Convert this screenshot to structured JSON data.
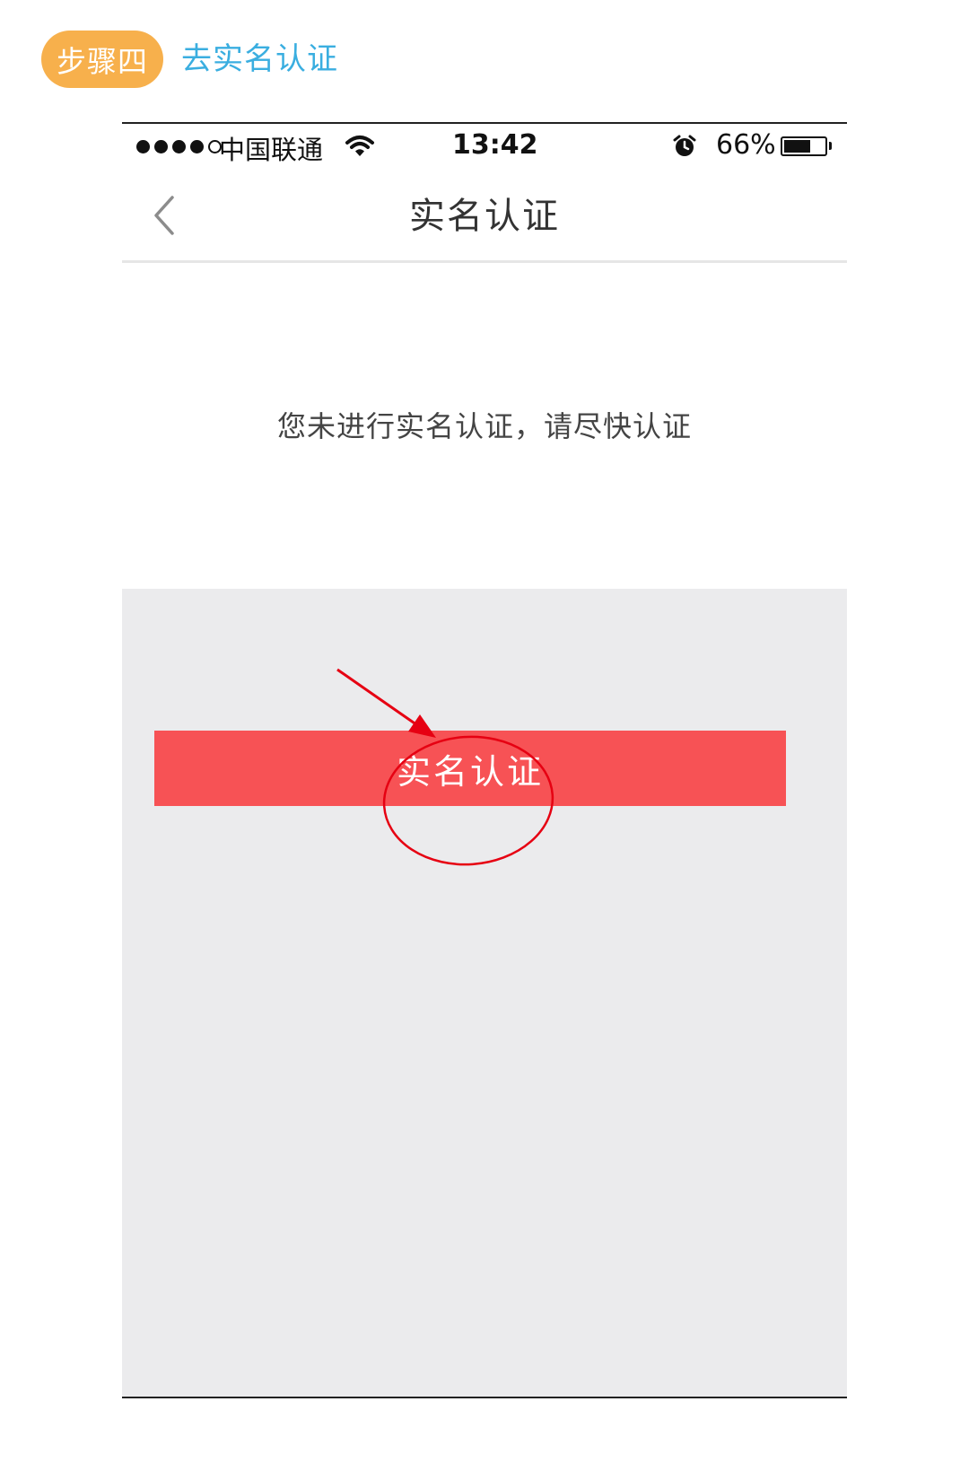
{
  "step": {
    "badge_label": "步骤四",
    "title": "去实名认证",
    "badge_color": "#F7B04C",
    "title_color": "#3AAEE0"
  },
  "status_bar": {
    "carrier": "中国联通",
    "time": "13:42",
    "battery": "66%",
    "battery_level": 0.66,
    "signal_bars_filled": 4,
    "signal_bars_total": 5
  },
  "nav": {
    "title": "实名认证",
    "back_icon": "chevron-left-icon"
  },
  "content": {
    "notice": "您未进行实名认证，请尽快认证"
  },
  "action": {
    "button_label": "实名认证",
    "button_color": "#F75255"
  },
  "annotation": {
    "color": "#E60012",
    "shapes": [
      "arrow",
      "ellipse"
    ]
  }
}
